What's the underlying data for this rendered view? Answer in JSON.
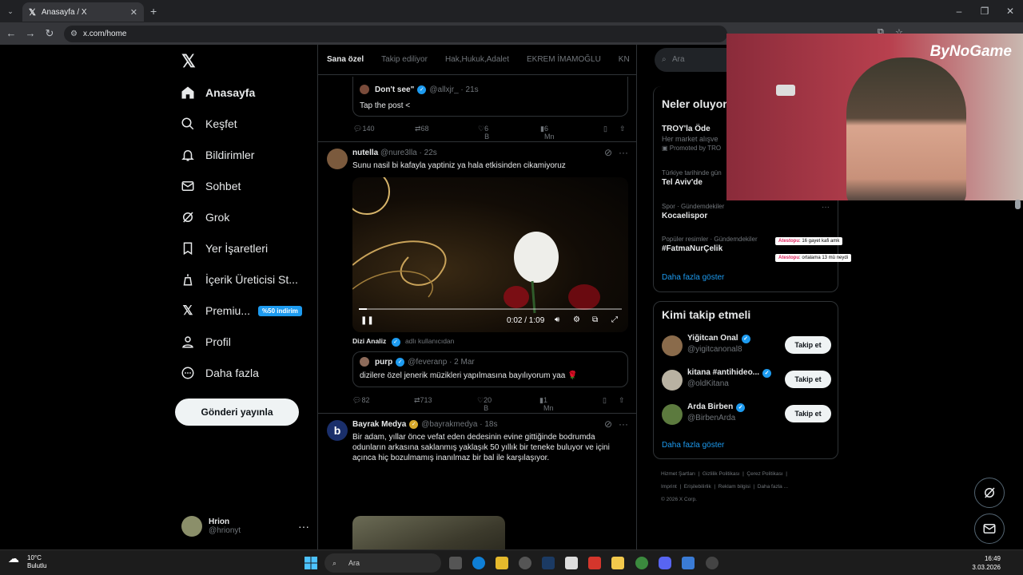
{
  "browser": {
    "tab_title": "Anasayfa / X",
    "url": "x.com/home"
  },
  "sidebar": {
    "items": [
      {
        "label": "Anasayfa",
        "icon": "home-icon"
      },
      {
        "label": "Keşfet",
        "icon": "search-icon"
      },
      {
        "label": "Bildirimler",
        "icon": "bell-icon"
      },
      {
        "label": "Sohbet",
        "icon": "mail-icon"
      },
      {
        "label": "Grok",
        "icon": "grok-icon"
      },
      {
        "label": "Yer İşaretleri",
        "icon": "bookmark-icon"
      },
      {
        "label": "İçerik Üreticisi St...",
        "icon": "creator-icon"
      },
      {
        "label": "Premiu...",
        "icon": "x-icon"
      },
      {
        "label": "Profil",
        "icon": "person-icon"
      },
      {
        "label": "Daha fazla",
        "icon": "more-circle-icon"
      }
    ],
    "premium_badge": "%50 indirim",
    "post_button": "Gönderi yayınla",
    "user": {
      "name": "Hrion",
      "handle": "@hrionyt"
    }
  },
  "feed": {
    "tabs": [
      "Sana özel",
      "Takip ediliyor",
      "Hak,Hukuk,Adalet",
      "EKREM İMAMOĞLU",
      "KN"
    ],
    "top_quote": {
      "name": "Don't see\"",
      "handle": "@allxjr_",
      "time": "· 21s",
      "text": "Tap the post  <"
    },
    "top_actions": {
      "replies": "140",
      "reposts": "68",
      "likes": "6 B",
      "views": "6 Mn"
    },
    "post1": {
      "name": "nutella",
      "handle": "@nure3lla",
      "time": "· 22s",
      "text": "Sunu nasil bi kafayla yaptiniz ya hala etkisinden cikamiyoruz",
      "video_time": "0:02 / 1:09",
      "video_progress": 0.03,
      "attribution_user": "Dizi Analiz",
      "attribution_text": "adlı kullanıcıdan",
      "quote": {
        "name": "purp",
        "handle": "@feveranp",
        "time": "· 2 Mar",
        "text": "dizilere özel jenerik müzikleri yapılmasına bayılıyorum yaa 🌹"
      },
      "actions": {
        "replies": "82",
        "reposts": "713",
        "likes": "20 B",
        "views": "1 Mn"
      }
    },
    "post2": {
      "name": "Bayrak Medya",
      "handle": "@bayrakmedya",
      "time": "· 18s",
      "text": "Bir adam, yıllar önce vefat eden dedesinin evine gittiğinde bodrumda odunların arkasına saklanmış yaklaşık 50 yıllık bir teneke buluyor ve içini açınca hiç bozulmamış inanılmaz bir bal ile karşılaşıyor."
    }
  },
  "right": {
    "search_placeholder": "Ara",
    "trends_title": "Neler oluyor",
    "trends": [
      {
        "kicker": "",
        "title": "TROY'la Öde",
        "sub": "Her market alışve",
        "promo": "Promoted by TRO"
      },
      {
        "kicker": "Türkiye tarihinde gün",
        "title": "Tel Aviv'de"
      },
      {
        "kicker": "Spor · Gündemdekiler",
        "title": "Kocaelispor"
      },
      {
        "kicker": "Popüler resimler · Gündemdekiler",
        "title": "#FatmaNurÇelik"
      }
    ],
    "trends_more": "Daha fazla göster",
    "who_title": "Kimi takip etmeli",
    "who": [
      {
        "name": "Yiğitcan Önal",
        "handle": "@yigitcanonal8",
        "btn": "Takip et"
      },
      {
        "name": "kitana #antihideo...",
        "handle": "@oldKitana",
        "btn": "Takip et"
      },
      {
        "name": "Arda Birben",
        "handle": "@BirbenArda",
        "btn": "Takip et"
      }
    ],
    "who_more": "Daha fazla göster",
    "footer": [
      "Hizmet Şartları",
      "Gizlilik Politikası",
      "Çerez Politikası",
      "Imprint",
      "Erişilebilirlik",
      "Reklam bilgisi",
      "Daha fazla ...",
      "© 2026 X Corp."
    ]
  },
  "overlay": {
    "watermark": "ByNoGame",
    "chat": [
      {
        "user": "Atestopu",
        "msg": ": 16 gayet kafi amk"
      },
      {
        "user": "Atestopu",
        "msg": ": ortalama 13 mü neydi"
      }
    ]
  },
  "taskbar": {
    "temp": "10°C",
    "weather": "Bulutlu",
    "search": "Ara",
    "time": "16:49",
    "date": "3.03.2026"
  }
}
